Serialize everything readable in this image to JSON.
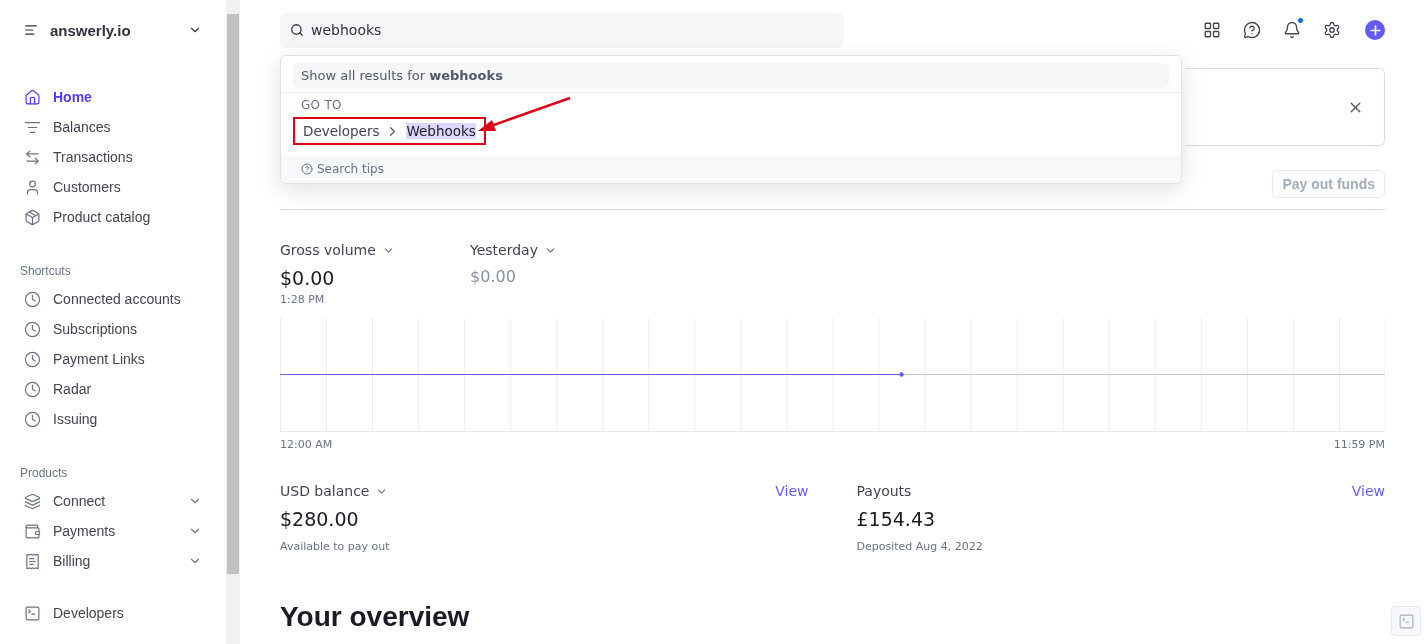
{
  "account": {
    "name": "answerly.io"
  },
  "sidebar": {
    "items": [
      {
        "label": "Home",
        "selected": true
      },
      {
        "label": "Balances",
        "selected": false
      },
      {
        "label": "Transactions",
        "selected": false
      },
      {
        "label": "Customers",
        "selected": false
      },
      {
        "label": "Product catalog",
        "selected": false
      }
    ],
    "sections": [
      {
        "title": "Shortcuts",
        "items": [
          {
            "label": "Connected accounts",
            "expandable": false
          },
          {
            "label": "Subscriptions",
            "expandable": false
          },
          {
            "label": "Payment Links",
            "expandable": false
          },
          {
            "label": "Radar",
            "expandable": false
          },
          {
            "label": "Issuing",
            "expandable": false
          }
        ]
      },
      {
        "title": "Products",
        "items": [
          {
            "label": "Connect",
            "expandable": true
          },
          {
            "label": "Payments",
            "expandable": true
          },
          {
            "label": "Billing",
            "expandable": true
          }
        ]
      }
    ],
    "footer_item": {
      "label": "Developers"
    }
  },
  "search": {
    "value": "webhooks",
    "dropdown": {
      "show_all": "Show all results for **webhooks**",
      "section": "GO TO",
      "results": [
        {
          "path": [
            "Developers",
            "Webhooks"
          ],
          "selected": true
        }
      ],
      "tips": "Search tips"
    }
  },
  "header_icons": [
    {
      "kind": "apps",
      "badge": false
    },
    {
      "kind": "help",
      "badge": false
    },
    {
      "kind": "bell",
      "badge": true
    },
    {
      "kind": "settings",
      "badge": false
    },
    {
      "kind": "create",
      "badge": false
    }
  ],
  "today": {
    "button": "Pay out funds",
    "metrics": [
      {
        "label": "Gross volume",
        "value": "$0.00",
        "muted": false,
        "note": "1:28 PM"
      },
      {
        "label": "Yesterday",
        "value": "$0.00",
        "muted": true
      }
    ],
    "chart": {
      "start_label": "12:00 AM",
      "end_label": "11:59 PM"
    }
  },
  "balances": [
    {
      "label": "USD balance",
      "has_menu": true,
      "link": "View",
      "value": "$280.00",
      "note": "Available to pay out"
    },
    {
      "label": "Payouts",
      "has_menu": false,
      "link": "View",
      "value": "£154.43",
      "note": "Deposited Aug 4, 2022"
    }
  ],
  "overview": {
    "title": "Your overview"
  }
}
